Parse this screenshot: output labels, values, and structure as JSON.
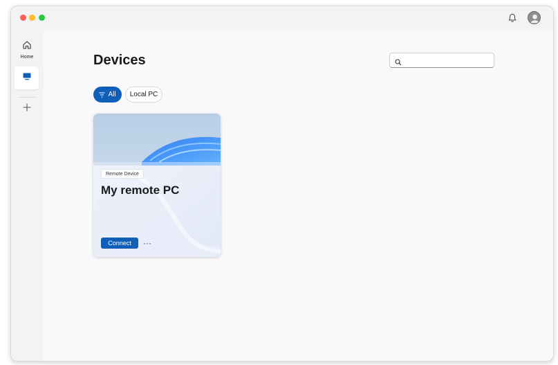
{
  "page": {
    "title": "Devices"
  },
  "sidebar": {
    "items": [
      {
        "label": "Home",
        "icon": "home-icon"
      },
      {
        "label": "",
        "icon": "monitor-icon",
        "selected": true
      },
      {
        "label": "",
        "icon": "plus-icon"
      }
    ]
  },
  "header": {
    "icons": [
      "bell-icon",
      "user-avatar-icon"
    ]
  },
  "search": {
    "placeholder": "",
    "value": ""
  },
  "filters": [
    {
      "label": "All",
      "icon": "filter-icon",
      "active": true
    },
    {
      "label": "Local PC",
      "active": false
    }
  ],
  "devices": [
    {
      "badge": "Remote Device",
      "name": "My remote PC",
      "connect_label": "Connect",
      "more_label": "···"
    }
  ],
  "colors": {
    "accent": "#0f5fb9",
    "background": "#f9f9fb",
    "sidebar": "#f3f3f3"
  }
}
